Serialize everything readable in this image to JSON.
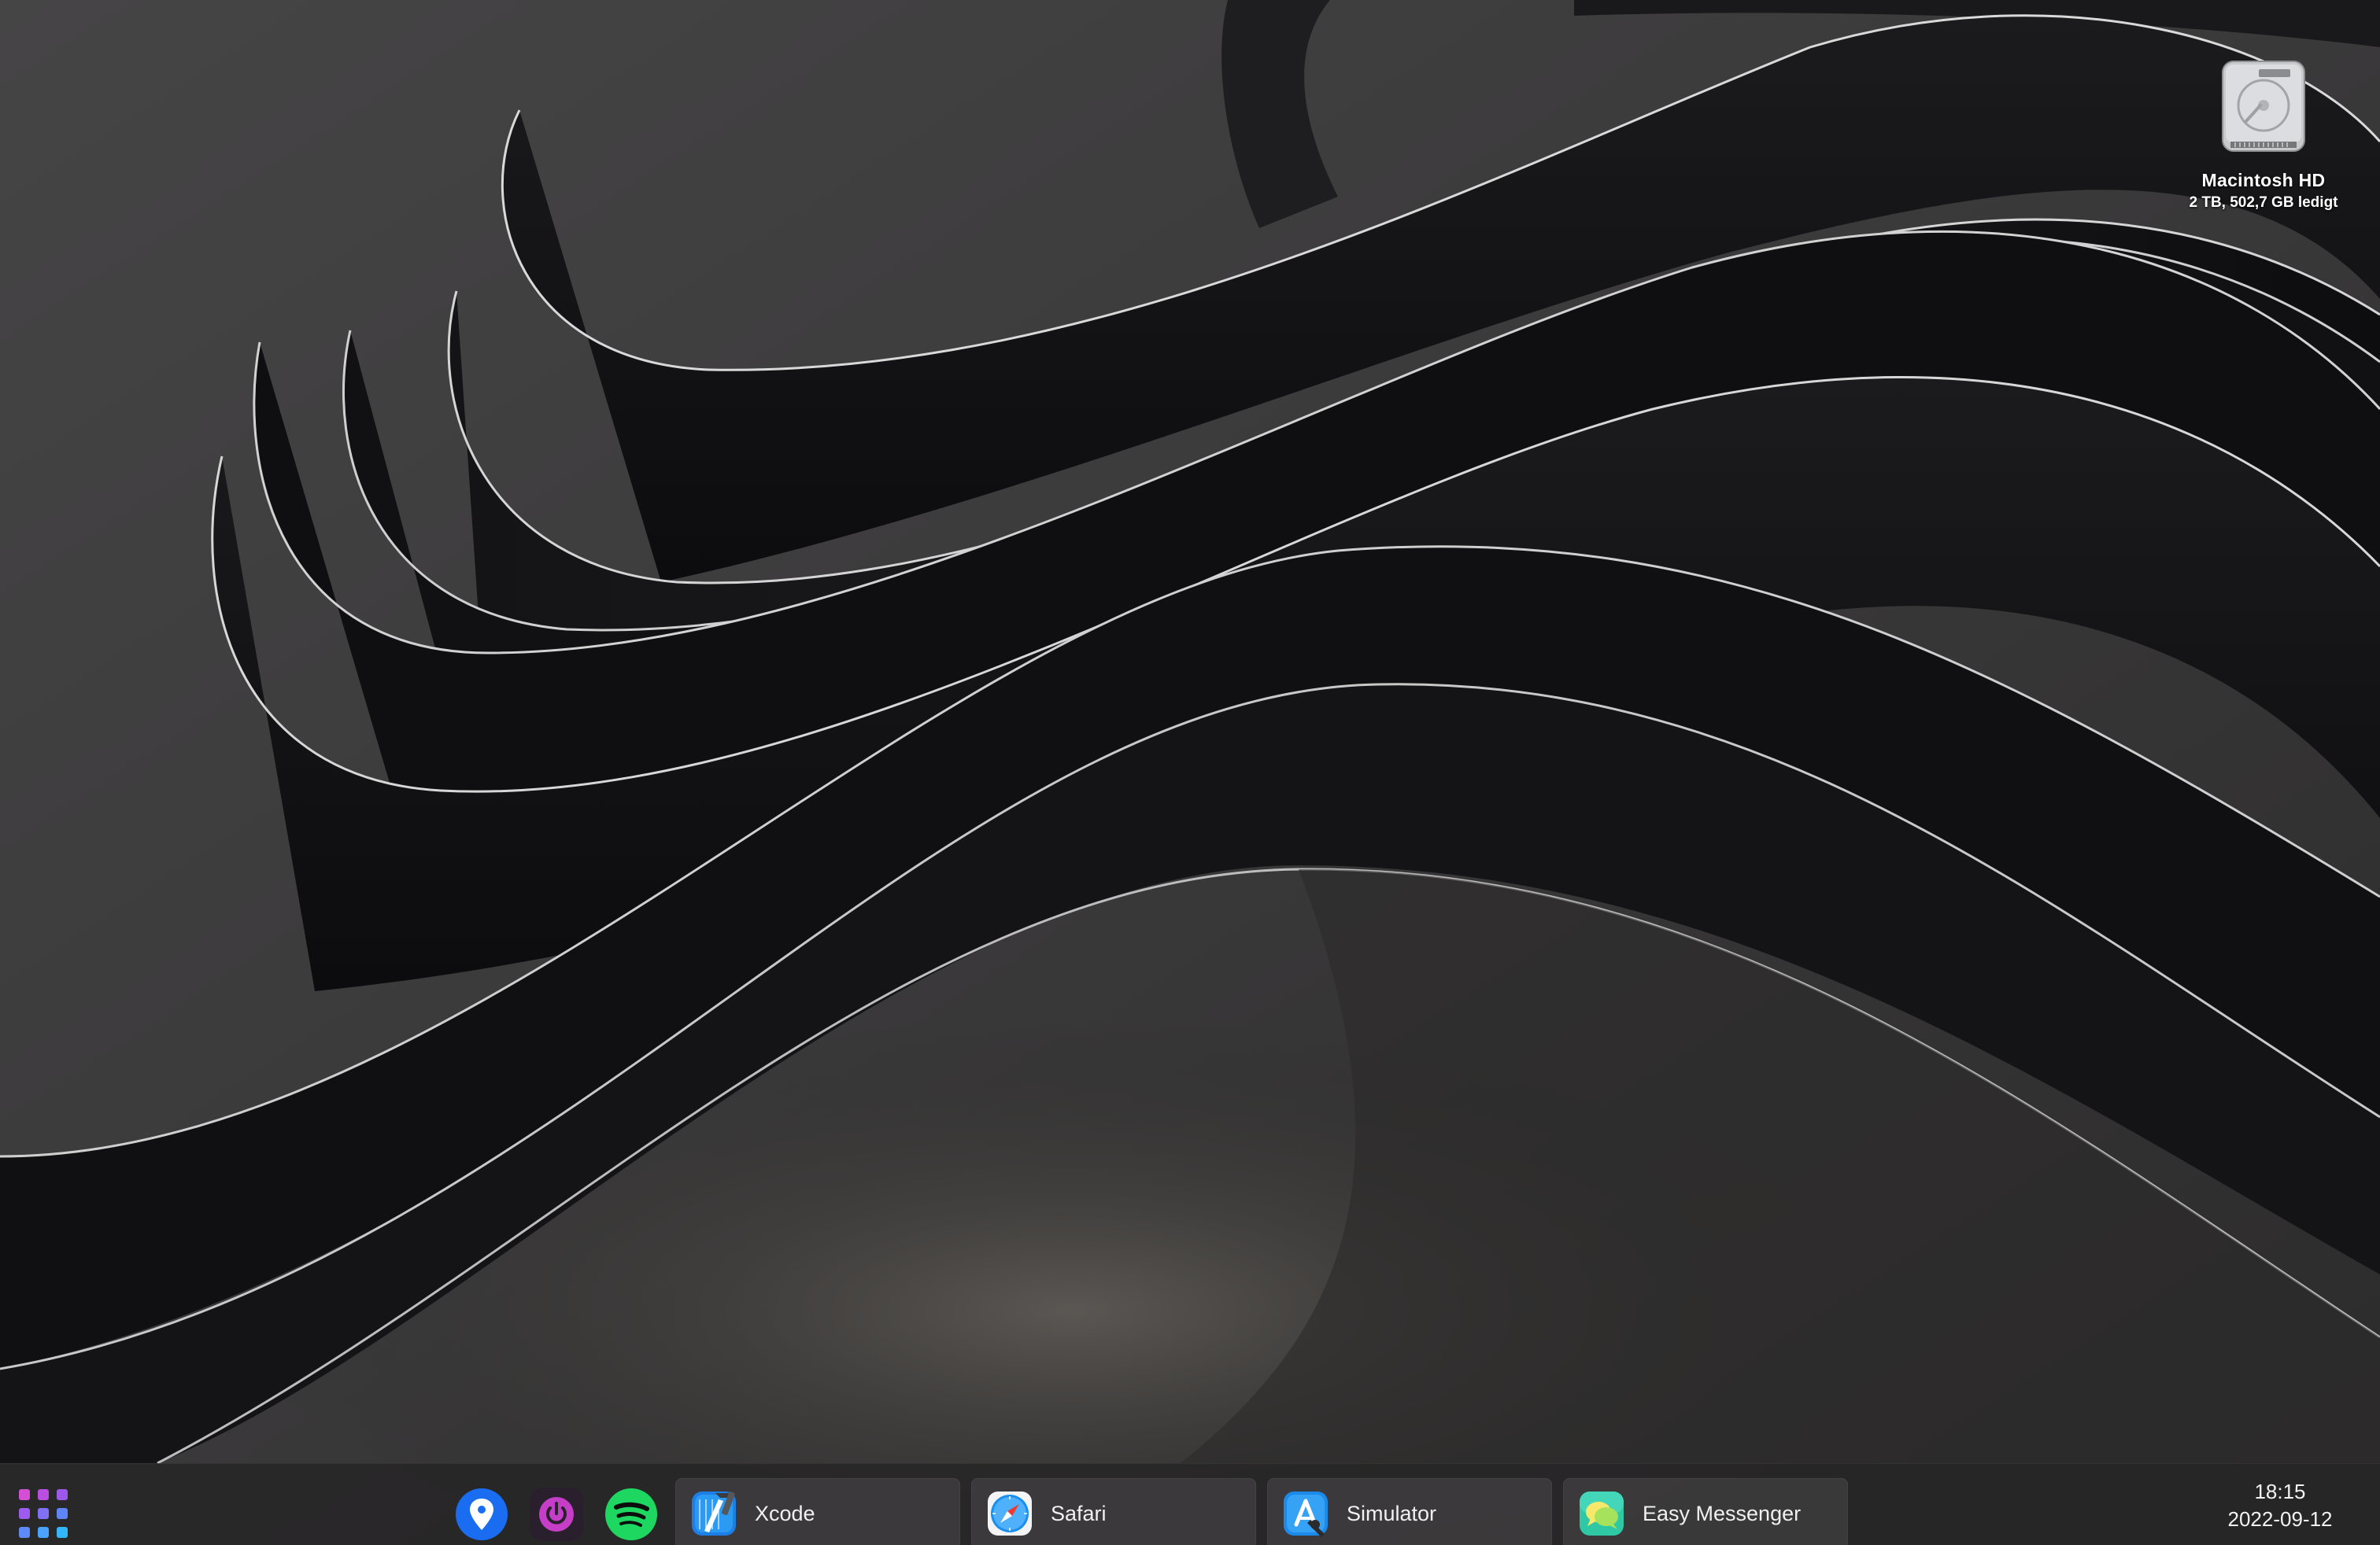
{
  "desktop": {
    "drive": {
      "icon": "hard-drive-icon",
      "name": "Macintosh HD",
      "info": "2 TB, 502,7 GB ledigt"
    }
  },
  "taskbar": {
    "launcher_icon": "app-grid-icon",
    "pinned": [
      {
        "name": "maps-pin-icon",
        "color": "#1a6cf0"
      },
      {
        "name": "power-icon",
        "color": "#c43ec7"
      },
      {
        "name": "spotify-icon",
        "color": "#1ed760"
      }
    ],
    "tasks": [
      {
        "label": "Xcode",
        "icon": "xcode-icon"
      },
      {
        "label": "Safari",
        "icon": "safari-icon"
      },
      {
        "label": "Simulator",
        "icon": "simulator-icon"
      },
      {
        "label": "Easy Messenger",
        "icon": "easy-messenger-icon"
      }
    ],
    "clock": {
      "time": "18:15",
      "date": "2022-09-12"
    }
  }
}
